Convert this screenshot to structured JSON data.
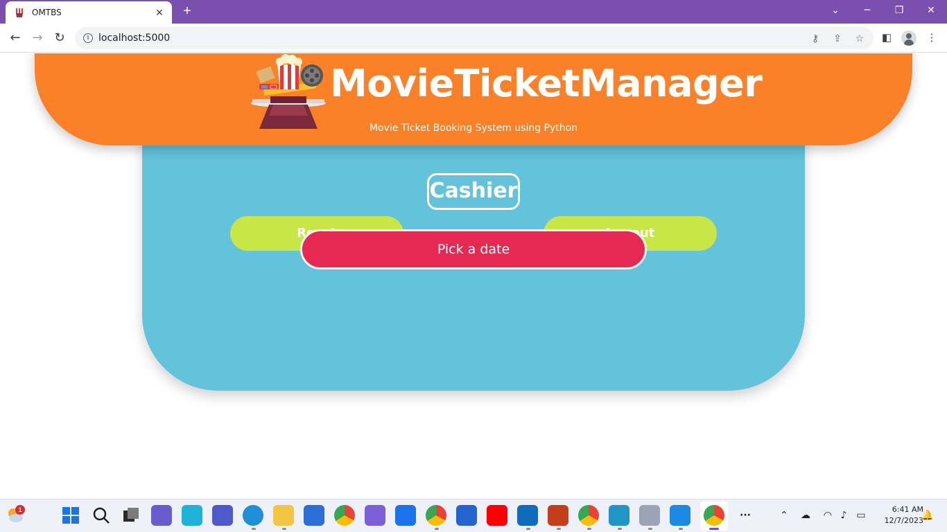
{
  "browser": {
    "tab_title": "OMTBS",
    "new_tab_symbol": "+",
    "url": "localhost:5000",
    "window_controls": {
      "minimize": "─",
      "restore": "❐",
      "close": "✕",
      "tab_search": "⌄"
    }
  },
  "header": {
    "title": "MovieTicketManager",
    "subtitle": "Movie Ticket Booking System using Python"
  },
  "actions": {
    "reset_label": "Reset",
    "role_label": "Cashier",
    "logout_label": "Logout",
    "pick_date_label": "Pick a date"
  },
  "taskbar": {
    "notification_badge": "1",
    "time": "6:41 AM",
    "date": "12/7/2023",
    "overflow": "···"
  },
  "colors": {
    "header_orange": "#fa8128",
    "panel_blue": "#63c3db",
    "button_lime": "#c8e646",
    "date_button_red": "#e52950",
    "titlebar_purple": "#7a4fae"
  }
}
